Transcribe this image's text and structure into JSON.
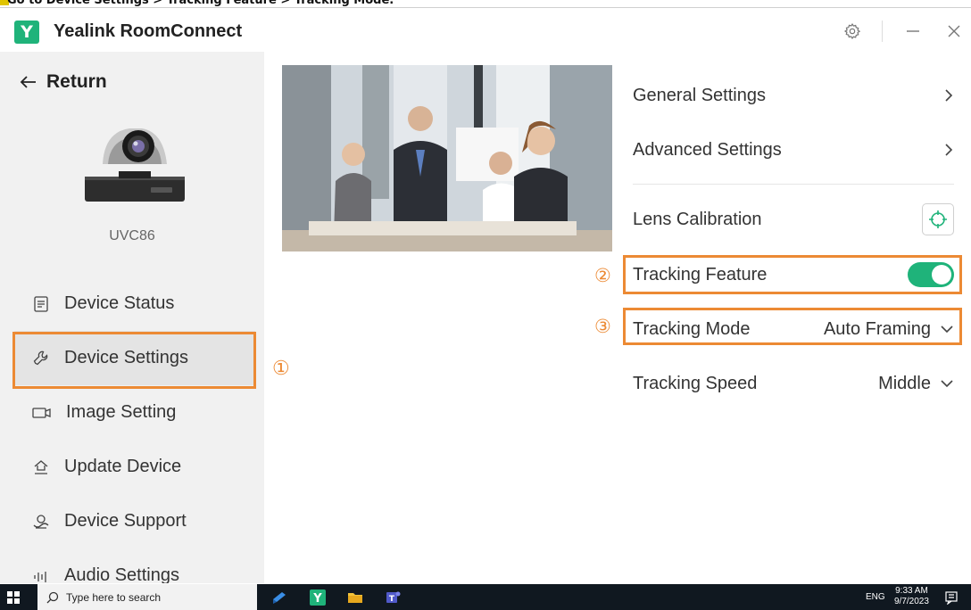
{
  "caption": "Go to Device Settings > Tracking Feature > Tracking Mode.",
  "app": {
    "title": "Yealink RoomConnect",
    "logo_letter": "Y"
  },
  "titlebar": {
    "icons": [
      "gear-icon",
      "minimize-icon",
      "close-icon"
    ]
  },
  "sidebar": {
    "return_label": "Return",
    "device_name": "UVC86",
    "items": [
      {
        "label": "Device Status",
        "icon": "list-icon"
      },
      {
        "label": "Device Settings",
        "icon": "wrench-icon",
        "active": true
      },
      {
        "label": "Image Setting",
        "icon": "camera-icon"
      },
      {
        "label": "Update Device",
        "icon": "upload-icon"
      },
      {
        "label": "Device Support",
        "icon": "support-icon"
      },
      {
        "label": "Audio Settings",
        "icon": "audio-icon"
      }
    ]
  },
  "settings": {
    "general": "General Settings",
    "advanced": "Advanced Settings",
    "lens": "Lens Calibration",
    "tracking_feature": {
      "label": "Tracking Feature",
      "enabled": true
    },
    "tracking_mode": {
      "label": "Tracking Mode",
      "value": "Auto Framing"
    },
    "tracking_speed": {
      "label": "Tracking Speed",
      "value": "Middle"
    }
  },
  "callouts": [
    "①",
    "②",
    "③"
  ],
  "taskbar": {
    "search_placeholder": "Type here to search",
    "lang": "ENG",
    "time": "9:33 AM",
    "date": "9/7/2023"
  },
  "colors": {
    "accent": "#1fb37a",
    "highlight": "#ec8a34",
    "sidebar_bg": "#f1f1f1"
  }
}
